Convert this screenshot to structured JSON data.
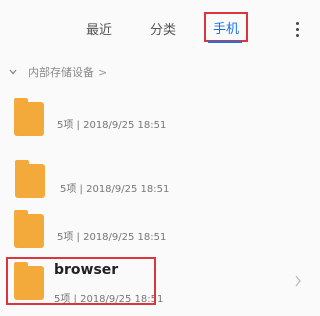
{
  "tabs": [
    {
      "label": "最近"
    },
    {
      "label": "分类"
    },
    {
      "label": "手机"
    }
  ],
  "breadcrumb": {
    "label": "内部存储设备",
    "separator": ">"
  },
  "items": [
    {
      "name": "",
      "meta": "5项 | 2018/9/25 18:51"
    },
    {
      "name": "",
      "meta": "5项 | 2018/9/25 18:51"
    },
    {
      "name": "",
      "meta": "5项 | 2018/9/25 18:51"
    },
    {
      "name": "browser",
      "meta": "5项 | 2018/9/25 18:51"
    }
  ],
  "colors": {
    "accent": "#1a73e8",
    "highlight": "#d9363e",
    "folder": "#f3aa3b"
  },
  "icons": {
    "more": "more-vert-icon",
    "expand": "chevron-down-icon",
    "open": "chevron-right-icon"
  }
}
